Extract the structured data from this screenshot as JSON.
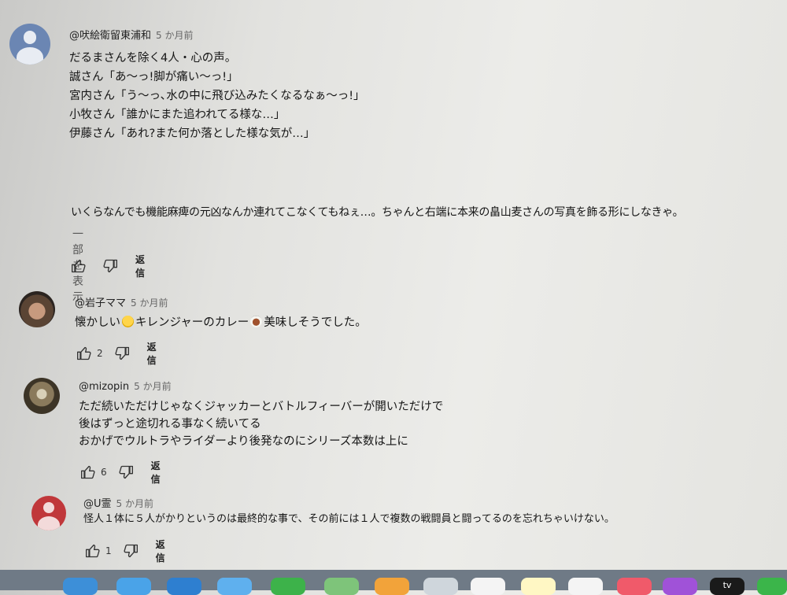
{
  "comments": [
    {
      "author": "@吠絵衛留東浦和",
      "time": "5 か月前",
      "lines": [
        "だるまさんを除く4人・心の声。",
        "誠さん「あ〜っ!脚が痛い〜っ!」",
        "宮内さん「う〜っ､水の中に飛び込みたくなるなぁ〜っ!」",
        "小牧さん「誰かにまた追われてる様な…」",
        "伊藤さん「あれ?また何か落とした様な気が…」",
        "いくらなんでも機能麻痺の元凶なんか連れてこなくてもねぇ…。ちゃんと右端に本来の畠山麦さんの写真を飾る形にしなきゃ。"
      ],
      "show_more": "一部を表示",
      "likes": "",
      "reply": "返信"
    },
    {
      "author": "@岩子ママ",
      "time": "5 か月前",
      "text_a": "懐かしい",
      "text_b": "キレンジャーのカレー",
      "text_c": "美味しそうでした。",
      "likes": "2",
      "reply": "返信"
    },
    {
      "author": "@mizopin",
      "time": "5 か月前",
      "lines": [
        "ただ続いただけじゃなくジャッカーとバトルフィーバーが開いただけで",
        "後はずっと途切れる事なく続いてる",
        "おかげでウルトラやライダーより後発なのにシリーズ本数は上に"
      ],
      "likes": "6",
      "reply": "返信"
    },
    {
      "author": "@U霊",
      "time": "5 か月前",
      "text": "怪人１体に５人がかりというのは最終的な事で、その前には１人で複数の戦闘員と闘ってるのを忘れちゃいけない。",
      "likes": "1",
      "reply": "返信"
    }
  ],
  "dock": {
    "tv_label": "tv"
  }
}
